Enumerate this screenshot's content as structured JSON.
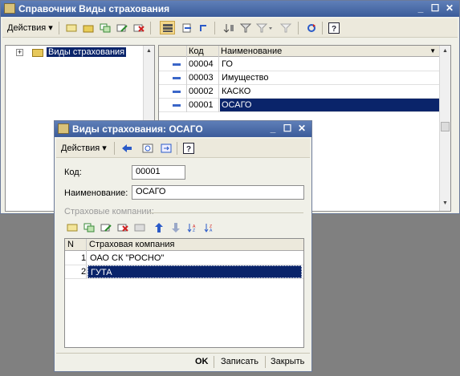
{
  "main_window": {
    "title": "Справочник Виды страхования",
    "actions_label": "Действия",
    "tree_root": "Виды страхования",
    "columns": [
      "Код",
      "Наименование"
    ],
    "rows": [
      {
        "code": "00004",
        "name": "ГО"
      },
      {
        "code": "00003",
        "name": "Имущество"
      },
      {
        "code": "00002",
        "name": "КАСКО"
      },
      {
        "code": "00001",
        "name": "ОСАГО"
      }
    ],
    "selected_row": 3
  },
  "dialog": {
    "title": "Виды страхования: ОСАГО",
    "actions_label": "Действия",
    "code_label": "Код:",
    "code_value": "00001",
    "name_label": "Наименование:",
    "name_value": "ОСАГО",
    "section_label": "Страховые компании:",
    "columns": [
      "N",
      "Страховая компания"
    ],
    "rows": [
      {
        "n": "1",
        "company": "ОАО СК \"РОСНО\""
      },
      {
        "n": "2",
        "company": "ГУТА"
      }
    ],
    "buttons": {
      "ok": "OK",
      "save": "Записать",
      "close": "Закрыть"
    }
  },
  "colors": {
    "title_bar": "#3b5c9a",
    "selection": "#0a246a",
    "row_marker": "#3a66c8"
  }
}
